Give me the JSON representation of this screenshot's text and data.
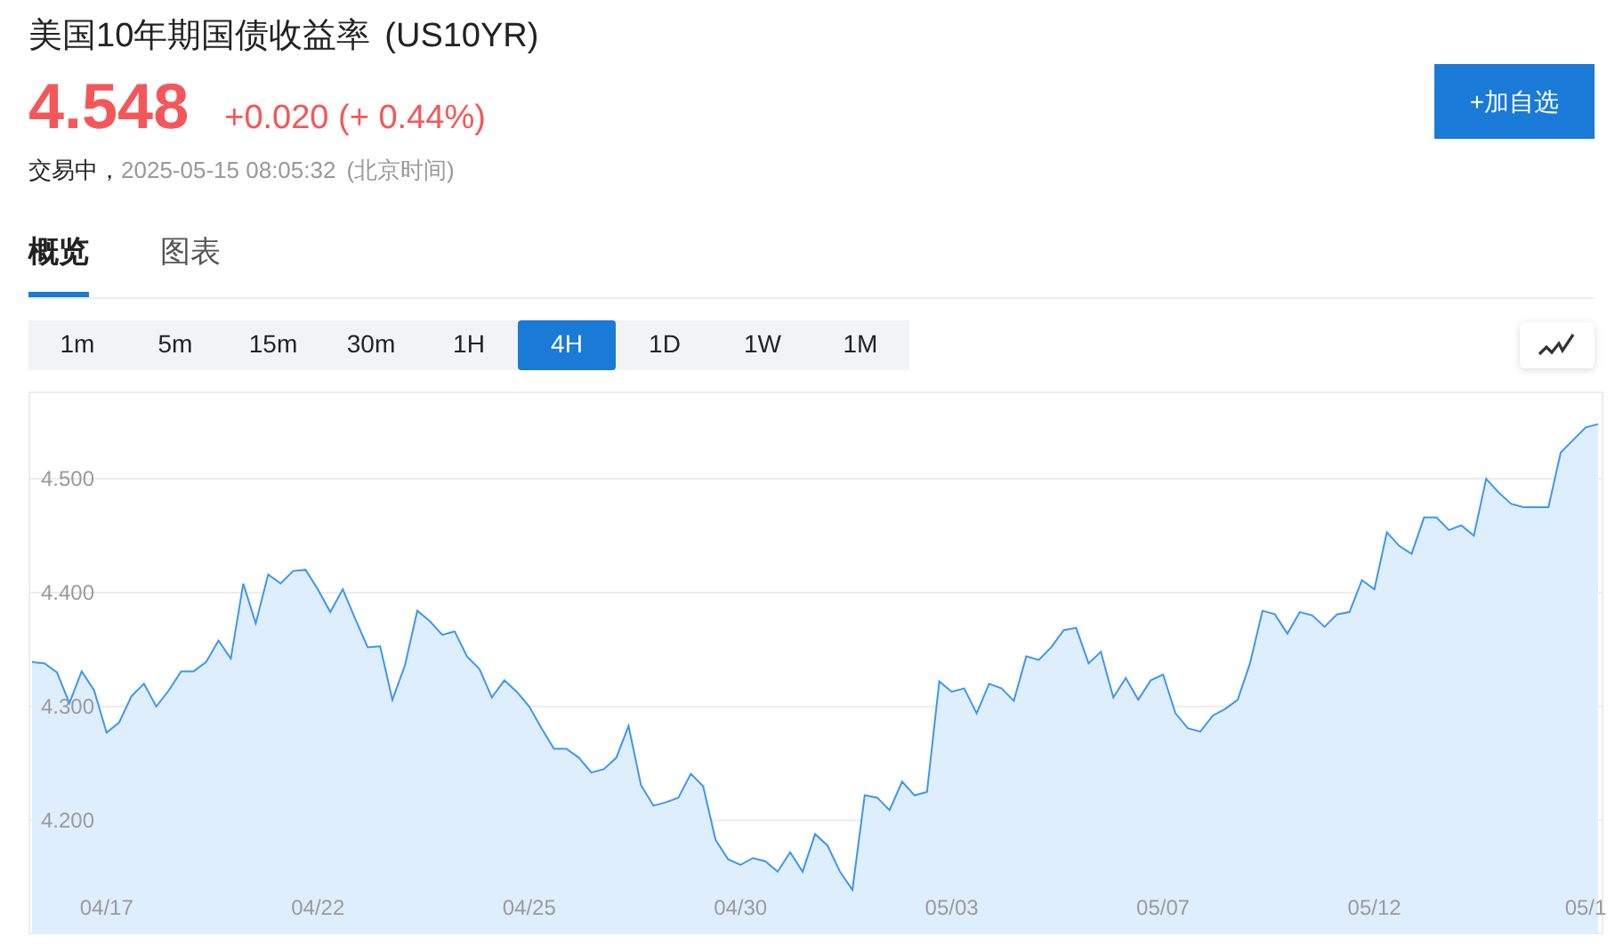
{
  "header": {
    "title": "美国10年期国债收益率",
    "symbol": "(US10YR)",
    "price": "4.548",
    "change": "+0.020 (+ 0.44%)",
    "status": "交易中，",
    "timestamp": "2025-05-15 08:05:32",
    "timezone": "(北京时间)",
    "add_button": "+加自选"
  },
  "tabs": [
    {
      "label": "概览",
      "selected": true
    },
    {
      "label": "图表",
      "selected": false
    }
  ],
  "periods": [
    {
      "label": "1m",
      "selected": false
    },
    {
      "label": "5m",
      "selected": false
    },
    {
      "label": "15m",
      "selected": false
    },
    {
      "label": "30m",
      "selected": false
    },
    {
      "label": "1H",
      "selected": false
    },
    {
      "label": "4H",
      "selected": true
    },
    {
      "label": "1D",
      "selected": false
    },
    {
      "label": "1W",
      "selected": false
    },
    {
      "label": "1M",
      "selected": false
    }
  ],
  "chart": {
    "chart_data": {
      "type": "area",
      "grid": true,
      "categories": [
        null,
        null,
        null,
        null,
        null,
        null,
        "04/17",
        null,
        null,
        null,
        null,
        null,
        null,
        null,
        null,
        null,
        null,
        null,
        null,
        null,
        null,
        null,
        null,
        "04/22",
        null,
        null,
        null,
        null,
        null,
        null,
        null,
        null,
        null,
        null,
        null,
        null,
        null,
        null,
        null,
        null,
        "04/25",
        null,
        null,
        null,
        null,
        null,
        null,
        null,
        null,
        null,
        null,
        null,
        null,
        null,
        null,
        null,
        null,
        "04/30",
        null,
        null,
        null,
        null,
        null,
        null,
        null,
        null,
        null,
        null,
        null,
        null,
        null,
        null,
        null,
        null,
        "05/03",
        null,
        null,
        null,
        null,
        null,
        null,
        null,
        null,
        null,
        null,
        null,
        null,
        null,
        null,
        null,
        null,
        "05/07",
        null,
        null,
        null,
        null,
        null,
        null,
        null,
        null,
        null,
        null,
        null,
        null,
        null,
        null,
        null,
        null,
        "05/12",
        null,
        null,
        null,
        null,
        null,
        null,
        null,
        null,
        null,
        null,
        null,
        null,
        null,
        null,
        null,
        null,
        "05/1",
        null
      ],
      "ylim": [
        4.1,
        4.575
      ],
      "yticks": [
        {
          "value": 4.2,
          "label": "4.200"
        },
        {
          "value": 4.3,
          "label": "4.300"
        },
        {
          "value": 4.4,
          "label": "4.400"
        },
        {
          "value": 4.5,
          "label": "4.500"
        }
      ],
      "series": [
        {
          "color": "#3d97f0",
          "values": [
            4.339,
            4.338,
            4.33,
            4.303,
            4.331,
            4.314,
            4.277,
            4.286,
            4.309,
            4.32,
            4.3,
            4.314,
            4.331,
            4.331,
            4.339,
            4.358,
            4.342,
            4.408,
            4.373,
            4.416,
            4.408,
            4.419,
            4.42,
            4.403,
            4.383,
            4.403,
            4.377,
            4.352,
            4.353,
            4.306,
            4.336,
            4.384,
            4.375,
            4.363,
            4.366,
            4.344,
            4.333,
            4.308,
            4.323,
            4.313,
            4.3,
            4.281,
            4.263,
            4.263,
            4.255,
            4.242,
            4.245,
            4.255,
            4.283,
            4.231,
            4.213,
            4.216,
            4.22,
            4.241,
            4.23,
            4.183,
            4.166,
            4.161,
            4.167,
            4.164,
            4.155,
            4.172,
            4.155,
            4.188,
            4.178,
            4.155,
            4.139,
            4.222,
            4.22,
            4.209,
            4.234,
            4.222,
            4.225,
            4.322,
            4.313,
            4.316,
            4.294,
            4.32,
            4.316,
            4.305,
            4.344,
            4.341,
            4.352,
            4.367,
            4.369,
            4.338,
            4.348,
            4.308,
            4.325,
            4.306,
            4.323,
            4.328,
            4.294,
            4.281,
            4.278,
            4.292,
            4.298,
            4.306,
            4.338,
            4.384,
            4.381,
            4.364,
            4.383,
            4.38,
            4.37,
            4.381,
            4.383,
            4.411,
            4.403,
            4.453,
            4.441,
            4.434,
            4.466,
            4.466,
            4.455,
            4.459,
            4.45,
            4.5,
            4.488,
            4.478,
            4.475,
            4.475,
            4.475,
            4.523,
            4.534,
            4.545,
            4.548
          ]
        }
      ]
    }
  }
}
